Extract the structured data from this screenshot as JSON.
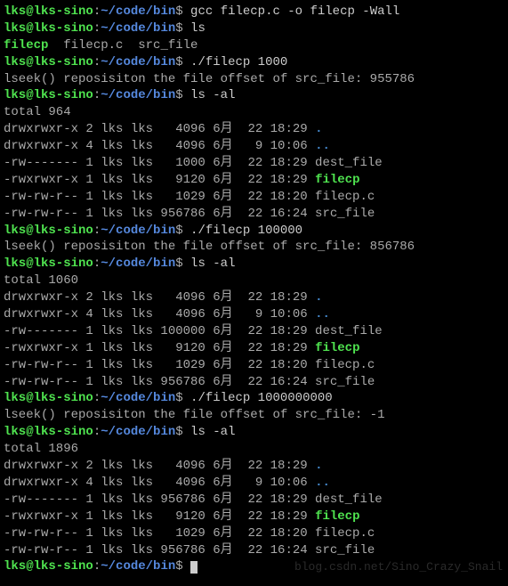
{
  "prompt": {
    "user_host": "lks@lks-sino",
    "colon": ":",
    "path": "~/code/bin",
    "dollar": "$"
  },
  "cmd1": "gcc filecp.c -o filecp -Wall",
  "cmd2": "ls",
  "ls1_files": {
    "f1": "filecp",
    "f2": "  filecp.c  src_file"
  },
  "cmd3": "./filecp 1000",
  "out3": "lseek() reposisiton the file offset of src_file: 955786",
  "cmd4": "ls -al",
  "ls4_total": "total 964",
  "ls4": [
    "drwxrwxr-x 2 lks lks   4096 6月  22 18:29 ",
    "drwxrwxr-x 4 lks lks   4096 6月   9 10:06 ",
    "-rw------- 1 lks lks   1000 6月  22 18:29 dest_file",
    "-rwxrwxr-x 1 lks lks   9120 6月  22 18:29 ",
    "-rw-rw-r-- 1 lks lks   1029 6月  22 18:20 filecp.c",
    "-rw-rw-r-- 1 lks lks 956786 6月  22 16:24 src_file"
  ],
  "ls4_names": {
    "dot": ".",
    "dotdot": "..",
    "filecp": "filecp"
  },
  "cmd5": "./filecp 100000",
  "out5": "lseek() reposisiton the file offset of src_file: 856786",
  "cmd6": "ls -al",
  "ls6_total": "total 1060",
  "ls6": [
    "drwxrwxr-x 2 lks lks   4096 6月  22 18:29 ",
    "drwxrwxr-x 4 lks lks   4096 6月   9 10:06 ",
    "-rw------- 1 lks lks 100000 6月  22 18:29 dest_file",
    "-rwxrwxr-x 1 lks lks   9120 6月  22 18:29 ",
    "-rw-rw-r-- 1 lks lks   1029 6月  22 18:20 filecp.c",
    "-rw-rw-r-- 1 lks lks 956786 6月  22 16:24 src_file"
  ],
  "cmd7": "./filecp 1000000000",
  "out7": "lseek() reposisiton the file offset of src_file: -1",
  "cmd8": "ls -al",
  "ls8_total": "total 1896",
  "ls8": [
    "drwxrwxr-x 2 lks lks   4096 6月  22 18:29 ",
    "drwxrwxr-x 4 lks lks   4096 6月   9 10:06 ",
    "-rw------- 1 lks lks 956786 6月  22 18:29 dest_file",
    "-rwxrwxr-x 1 lks lks   9120 6月  22 18:29 ",
    "-rw-rw-r-- 1 lks lks   1029 6月  22 18:20 filecp.c",
    "-rw-rw-r-- 1 lks lks 956786 6月  22 16:24 src_file"
  ],
  "watermark": "blog.csdn.net/Sino_Crazy_Snail"
}
